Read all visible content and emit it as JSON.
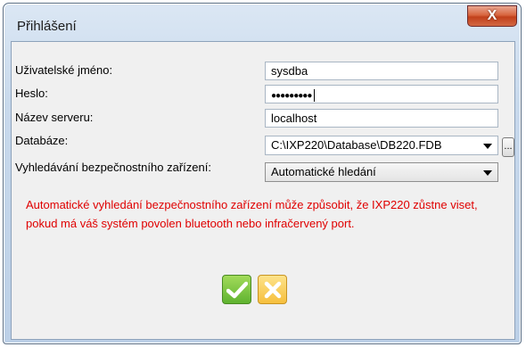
{
  "window": {
    "title": "Přihlášení",
    "close_glyph": "X"
  },
  "form": {
    "username": {
      "label": "Uživatelské jméno:",
      "value": "sysdba"
    },
    "password": {
      "label": "Heslo:",
      "masked_value": "●●●●●●●●●"
    },
    "server": {
      "label": "Název serveru:",
      "value": "localhost"
    },
    "database": {
      "label": "Databáze:",
      "value": "C:\\IXP220\\Database\\DB220.FDB",
      "browse_label": "..."
    },
    "device_search": {
      "label": "Vyhledávání bezpečnostního zařízení:",
      "selected": "Automatické hledání"
    }
  },
  "warning_text": "Automatické vyhledání bezpečnostního zařízení může způsobit, že IXP220 zůstne viset, pokud má váš systém povolen bluetooth nebo infračervený port.",
  "icons": {
    "ok": "check-icon",
    "cancel": "x-icon"
  },
  "colors": {
    "warning": "#e00000",
    "ok_green": "#5fb330",
    "cancel_yellow": "#f6bf3e"
  }
}
